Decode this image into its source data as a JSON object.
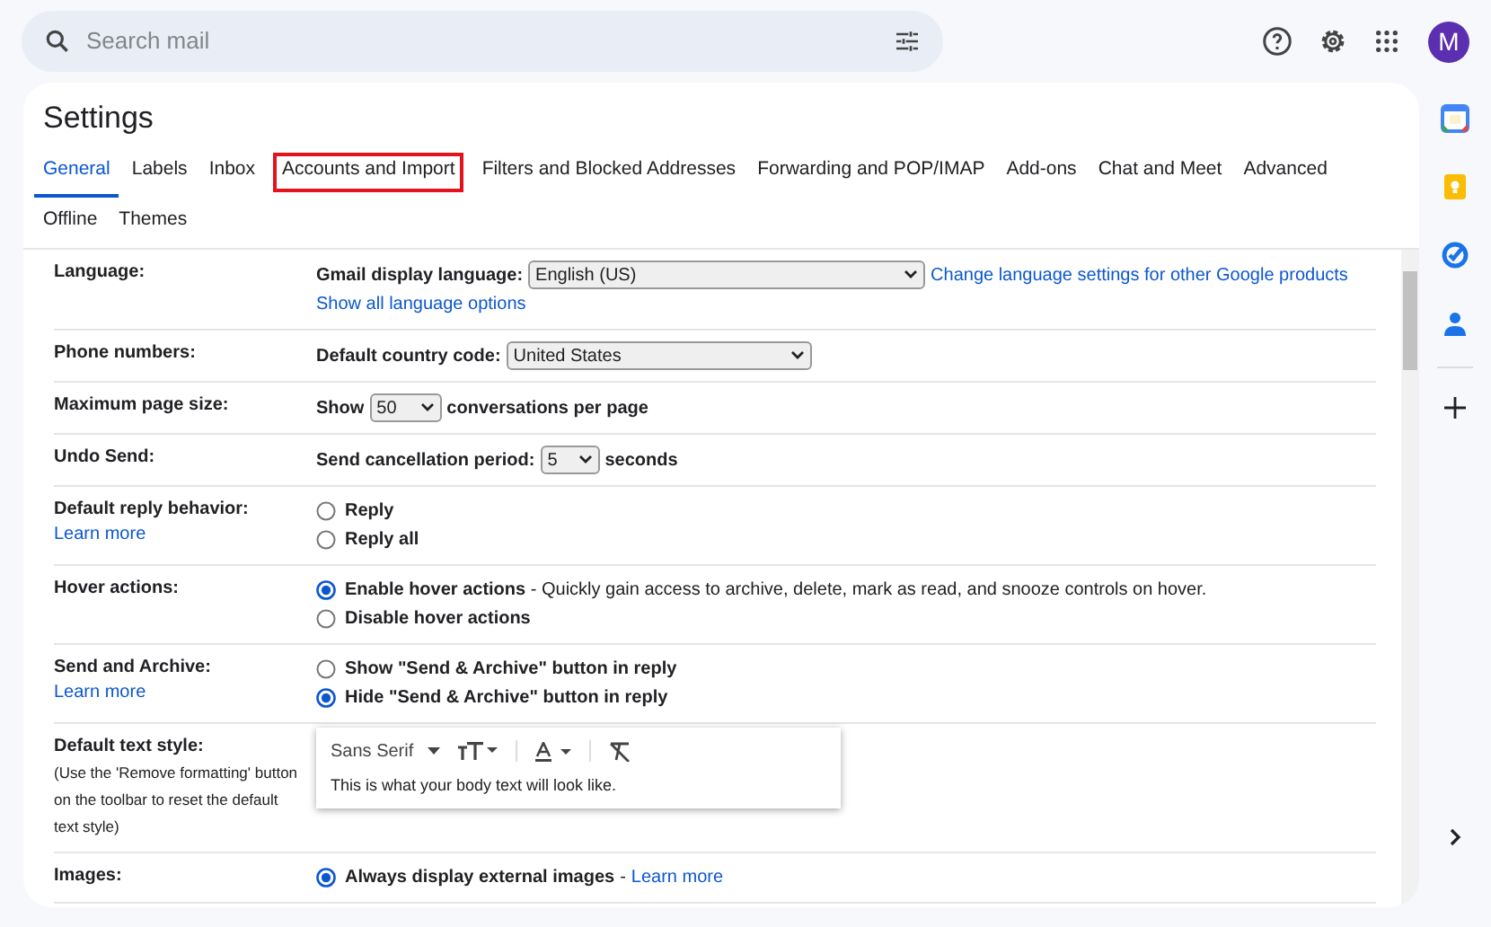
{
  "search": {
    "placeholder": "Search mail"
  },
  "avatar": {
    "letter": "M"
  },
  "page_title": "Settings",
  "tabs": [
    {
      "label": "General",
      "selected": true,
      "highlighted": false
    },
    {
      "label": "Labels",
      "selected": false,
      "highlighted": false
    },
    {
      "label": "Inbox",
      "selected": false,
      "highlighted": false
    },
    {
      "label": "Accounts and Import",
      "selected": false,
      "highlighted": true
    },
    {
      "label": "Filters and Blocked Addresses",
      "selected": false,
      "highlighted": false
    },
    {
      "label": "Forwarding and POP/IMAP",
      "selected": false,
      "highlighted": false
    },
    {
      "label": "Add-ons",
      "selected": false,
      "highlighted": false
    },
    {
      "label": "Chat and Meet",
      "selected": false,
      "highlighted": false
    },
    {
      "label": "Advanced",
      "selected": false,
      "highlighted": false
    },
    {
      "label": "Offline",
      "selected": false,
      "highlighted": false
    },
    {
      "label": "Themes",
      "selected": false,
      "highlighted": false
    }
  ],
  "settings": [
    {
      "label": "Language:",
      "lines": [
        [
          {
            "kind": "bold",
            "text": "Gmail display language:"
          },
          {
            "kind": "select",
            "value": "English (US)"
          },
          {
            "kind": "link",
            "text": "Change language settings for other Google products"
          }
        ],
        [
          {
            "kind": "link",
            "text": "Show all language options"
          }
        ]
      ]
    },
    {
      "label": "Phone numbers:",
      "lines": [
        [
          {
            "kind": "bold",
            "text": "Default country code:"
          },
          {
            "kind": "select",
            "value": "United States"
          }
        ]
      ]
    },
    {
      "label": "Maximum page size:",
      "lines": [
        [
          {
            "kind": "bold",
            "text": "Show"
          },
          {
            "kind": "select",
            "value": "50"
          },
          {
            "kind": "bold",
            "text": "conversations per page"
          }
        ]
      ]
    },
    {
      "label": "Undo Send:",
      "lines": [
        [
          {
            "kind": "bold",
            "text": "Send cancellation period:"
          },
          {
            "kind": "select",
            "value": "5"
          },
          {
            "kind": "bold",
            "text": "seconds"
          }
        ]
      ]
    },
    {
      "label": "Default reply behavior:",
      "learn_more": "Learn more",
      "lines": [
        [
          {
            "kind": "radio",
            "selected": false,
            "text": "Reply"
          }
        ],
        [
          {
            "kind": "radio",
            "selected": false,
            "text": "Reply all"
          }
        ]
      ]
    },
    {
      "label": "Hover actions:",
      "lines": [
        [
          {
            "kind": "radio",
            "selected": true,
            "text": "Enable hover actions",
            "description": "- Quickly gain access to archive, delete, mark as read, and snooze controls on hover."
          }
        ],
        [
          {
            "kind": "radio",
            "selected": false,
            "text": "Disable hover actions"
          }
        ]
      ]
    },
    {
      "label": "Send and Archive:",
      "learn_more": "Learn more",
      "lines": [
        [
          {
            "kind": "radio",
            "selected": false,
            "text": "Show \"Send & Archive\" button in reply"
          }
        ],
        [
          {
            "kind": "radio",
            "selected": true,
            "text": "Hide \"Send & Archive\" button in reply"
          }
        ]
      ]
    },
    {
      "label": "Default text style:",
      "note": "(Use the 'Remove formatting' button on the toolbar to reset the default text style)",
      "lines": [
        [
          {
            "kind": "editor",
            "font": "Sans Serif",
            "sample": "This is what your body text will look like."
          }
        ]
      ]
    },
    {
      "label": "Images:",
      "lines": [
        [
          {
            "kind": "radio",
            "selected": true,
            "text": "Always display external images",
            "description": "-",
            "link": "Learn more"
          }
        ]
      ]
    }
  ]
}
